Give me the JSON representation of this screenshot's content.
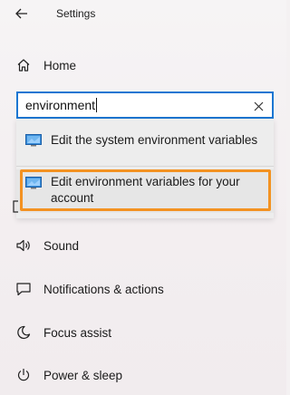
{
  "header": {
    "title": "Settings",
    "back_icon": "back-arrow-icon"
  },
  "nav": {
    "home": {
      "label": "Home",
      "icon": "home-icon"
    },
    "items": [
      {
        "label": "Sound",
        "icon": "speaker-icon"
      },
      {
        "label": "Notifications & actions",
        "icon": "notification-icon"
      },
      {
        "label": "Focus assist",
        "icon": "moon-icon"
      },
      {
        "label": "Power & sleep",
        "icon": "power-icon"
      }
    ]
  },
  "search": {
    "value": "environment",
    "clear_icon": "close-icon"
  },
  "suggestions": [
    {
      "label": "Edit the system environment variables",
      "icon": "monitor-icon"
    },
    {
      "label": "Edit environment variables for your account",
      "icon": "monitor-icon",
      "highlighted": true
    }
  ],
  "colors": {
    "accent": "#1976d2",
    "highlight": "#f39222",
    "dropdown_bg": "#ededed"
  }
}
